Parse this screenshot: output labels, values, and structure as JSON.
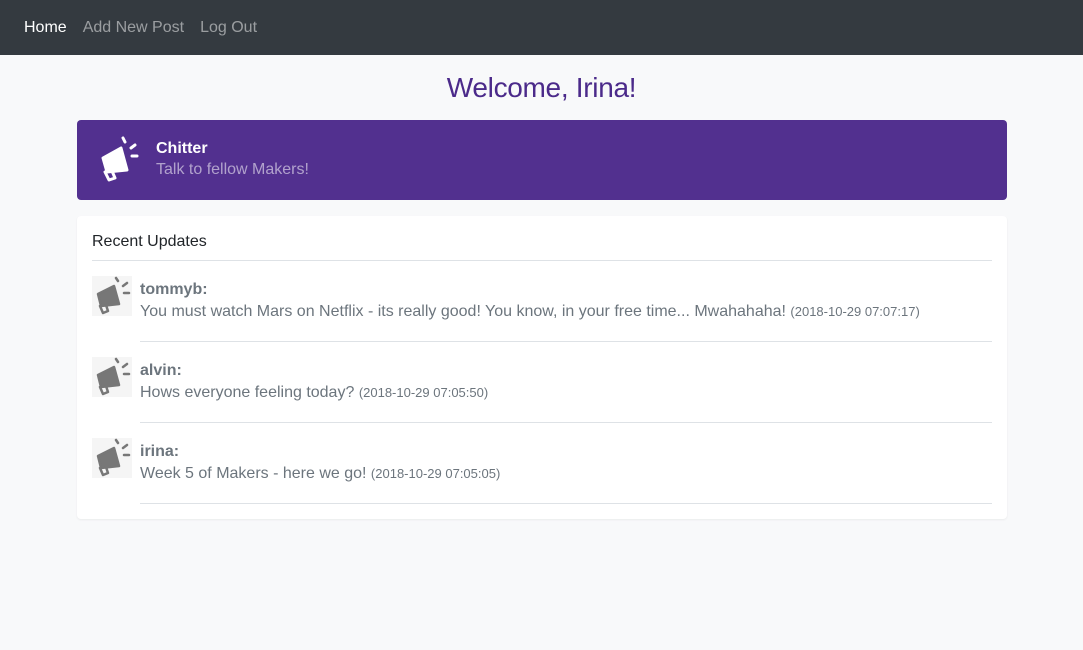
{
  "nav": {
    "home": "Home",
    "add_post": "Add New Post",
    "logout": "Log Out"
  },
  "welcome": "Welcome, Irina!",
  "banner": {
    "title": "Chitter",
    "subtitle": "Talk to fellow Makers!",
    "icon": "megaphone-icon"
  },
  "updates": {
    "heading": "Recent Updates",
    "posts": [
      {
        "user": "tommyb:",
        "text": "You must watch Mars on Netflix - its really good! You know, in your free time... Mwahahaha!",
        "time": "(2018-10-29 07:07:17)"
      },
      {
        "user": "alvin:",
        "text": "Hows everyone feeling today?",
        "time": "(2018-10-29 07:05:50)"
      },
      {
        "user": "irina:",
        "text": "Week 5 of Makers - here we go!",
        "time": "(2018-10-29 07:05:05)"
      }
    ]
  },
  "colors": {
    "navbar": "#343a40",
    "brand_purple": "#52308f",
    "welcome_purple": "#4b2a8a"
  }
}
